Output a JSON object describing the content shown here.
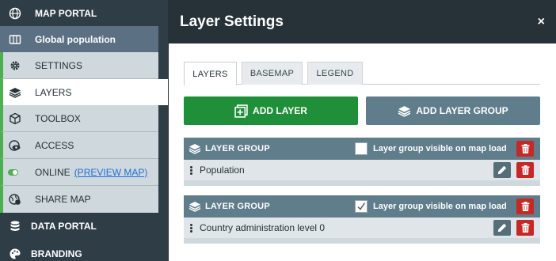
{
  "sidebar": {
    "map_portal": "MAP PORTAL",
    "map_title": "Global population",
    "settings": "SETTINGS",
    "layers": "LAYERS",
    "toolbox": "TOOLBOX",
    "access": "ACCESS",
    "online": "ONLINE",
    "preview_map": "(PREVIEW MAP)",
    "share_map": "SHARE MAP",
    "data_portal": "DATA PORTAL",
    "branding": "BRANDING"
  },
  "panel": {
    "title": "Layer Settings",
    "close": "×",
    "tabs": [
      "LAYERS",
      "BASEMAP",
      "LEGEND"
    ],
    "add_layer": "ADD LAYER",
    "add_layer_group": "ADD LAYER GROUP",
    "groups": [
      {
        "title": "LAYER GROUP",
        "visible_label": "Layer group visible on map load",
        "visible_checked": false,
        "layer": "Population"
      },
      {
        "title": "LAYER GROUP",
        "visible_label": "Layer group visible on map load",
        "visible_checked": true,
        "layer": "Country administration level 0"
      }
    ]
  },
  "colors": {
    "sidebar_bg": "#2f3e46",
    "accent_green": "#4caf50",
    "add_button": "#1f8f3a",
    "group_header": "#607d8b",
    "delete": "#c62828"
  }
}
